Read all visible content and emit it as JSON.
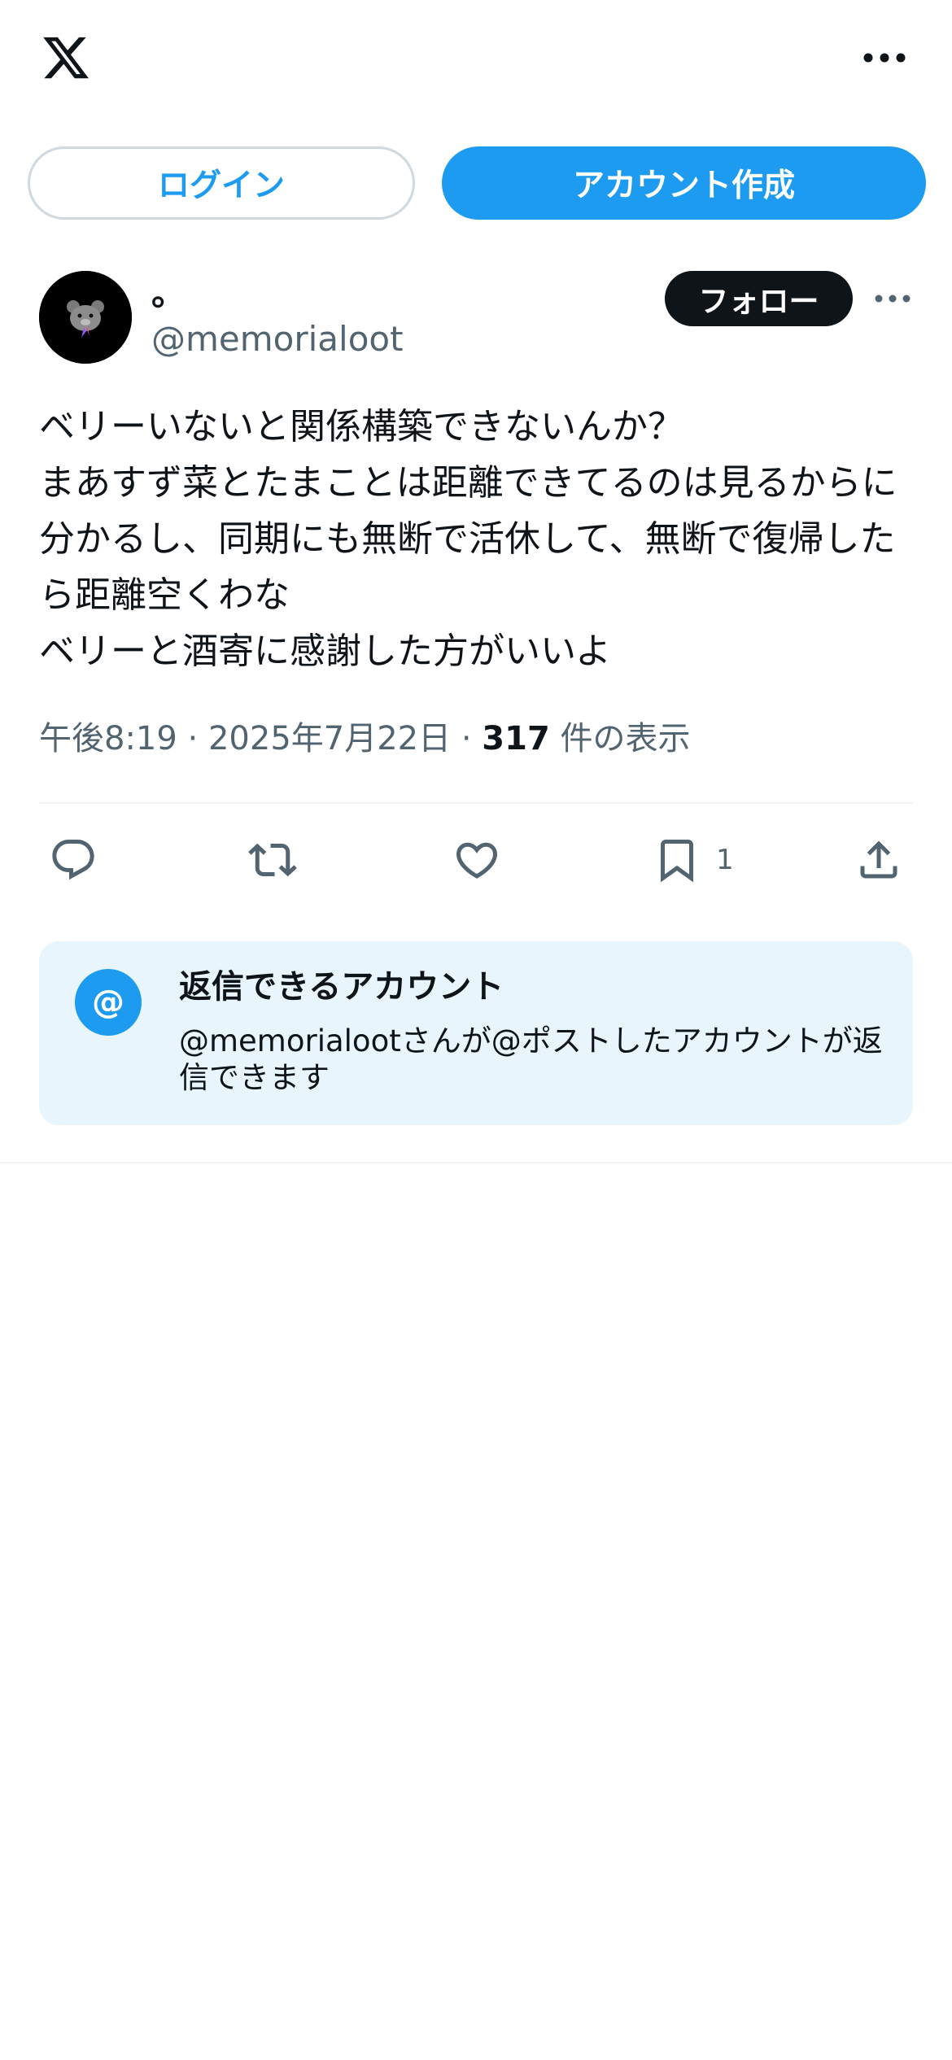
{
  "header": {
    "logo_icon": "x-logo-icon",
    "more_icon": "more-horizontal-icon"
  },
  "auth": {
    "login_label": "ログイン",
    "signup_label": "アカウント作成"
  },
  "author": {
    "display_name": "。",
    "handle": "@memorialoot",
    "follow_label": "フォロー"
  },
  "post": {
    "text": "ベリーいないと関係構築できないんか？\nまあすず菜とたまことは距離できてるのは見るからに分かるし、同期にも無断で活休して、無断で復帰したら距離空くわな\nベリーと酒寄に感謝した方がいいよ",
    "time": "午後8:19",
    "separator": "·",
    "date": "2025年7月22日",
    "views_count": "317",
    "views_label": "件の表示"
  },
  "actions": {
    "reply_icon": "reply-icon",
    "repost_icon": "repost-icon",
    "like_icon": "heart-icon",
    "bookmark_icon": "bookmark-icon",
    "bookmark_count": "1",
    "share_icon": "share-icon"
  },
  "reply_settings": {
    "at_symbol": "@",
    "title": "返信できるアカウント",
    "description": "@memorialootさんが@ポストしたアカウントが返信できます"
  },
  "colors": {
    "accent": "#1d9bf0",
    "text_primary": "#0f1419",
    "text_secondary": "#536471",
    "info_bg": "#e8f5fd"
  }
}
